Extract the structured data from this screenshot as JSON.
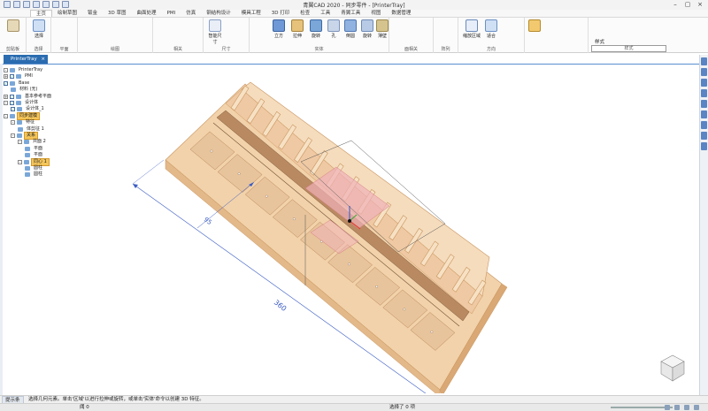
{
  "app": {
    "title": "青翼CAD 2020 - 同步零件 - [PrinterTray]"
  },
  "menu": {
    "tabs": [
      "主页",
      "绘制草图",
      "钣金",
      "3D 草图",
      "曲面处理",
      "PMI",
      "仿真",
      "钢结构设计",
      "模具工程",
      "3D 打印",
      "检查",
      "工具",
      "青翼工具",
      "视图",
      "数据管理"
    ],
    "active_index": 0
  },
  "ribbon": {
    "groups": [
      {
        "name": "剪贴板"
      },
      {
        "name": "选择"
      },
      {
        "name": "平面"
      },
      {
        "name": "绘图"
      },
      {
        "name": "相关"
      },
      {
        "name": "尺寸"
      },
      {
        "name": "实体"
      },
      {
        "name": "面相关"
      },
      {
        "name": "阵列"
      },
      {
        "name": "方向"
      },
      {
        "name": "样式"
      }
    ],
    "buttons": {
      "select": "选择",
      "smart_dim": "智能尺寸",
      "extrude": "立方",
      "stretch": "拉伸",
      "revolve": "旋转",
      "hole": "孔",
      "round": "倒圆",
      "rotate": "旋转",
      "thin": "薄壁",
      "scale": "缩放区域",
      "views": "适合"
    },
    "style_label": "样式"
  },
  "panel": {
    "tab_label": "PrinterTray",
    "close": "×"
  },
  "tree": [
    {
      "label": "PrinterTray",
      "depth": 0,
      "expander": "-",
      "checkbox": false,
      "highlight": false
    },
    {
      "label": "PMI",
      "depth": 0,
      "expander": "+",
      "checkbox": true,
      "highlight": false
    },
    {
      "label": "Base",
      "depth": 0,
      "expander": "",
      "checkbox": true,
      "highlight": false
    },
    {
      "label": "材料 (无)",
      "depth": 1,
      "expander": "",
      "checkbox": false,
      "highlight": false
    },
    {
      "label": "基本参考平面",
      "depth": 0,
      "expander": "+",
      "checkbox": true,
      "highlight": false
    },
    {
      "label": "设计体",
      "depth": 0,
      "expander": "-",
      "checkbox": true,
      "highlight": false
    },
    {
      "label": "设计体_1",
      "depth": 1,
      "expander": "",
      "checkbox": true,
      "highlight": false
    },
    {
      "label": "同步建模",
      "depth": 0,
      "expander": "-",
      "checkbox": false,
      "highlight": true
    },
    {
      "label": "特征",
      "depth": 1,
      "expander": "-",
      "checkbox": false,
      "highlight": false
    },
    {
      "label": "体剪征 1",
      "depth": 2,
      "expander": "",
      "checkbox": false,
      "highlight": false
    },
    {
      "label": "关系",
      "depth": 1,
      "expander": "-",
      "checkbox": false,
      "highlight": true
    },
    {
      "label": "共面 2",
      "depth": 2,
      "expander": "-",
      "checkbox": false,
      "highlight": false
    },
    {
      "label": "平面",
      "depth": 3,
      "expander": "",
      "checkbox": false,
      "highlight": false
    },
    {
      "label": "平面",
      "depth": 3,
      "expander": "",
      "checkbox": false,
      "highlight": false
    },
    {
      "label": "同心 1",
      "depth": 2,
      "expander": "-",
      "checkbox": false,
      "highlight": true
    },
    {
      "label": "圆柱",
      "depth": 3,
      "expander": "",
      "checkbox": false,
      "highlight": false
    },
    {
      "label": "圆柱",
      "depth": 3,
      "expander": "",
      "checkbox": false,
      "highlight": false
    }
  ],
  "dimensions": {
    "d1": "360",
    "d2": "95"
  },
  "status": {
    "tab": "提示条",
    "message": "选择几何元素。单击'区域'以进行拉伸或旋转，或单击'实体'命令以创建 3D 特征。",
    "left": "阈 0",
    "selection": "选择了 0 项"
  },
  "colors": {
    "accent": "#2b6cb0",
    "part_top": "#f2d2aa",
    "part_side": "#e3b98a",
    "part_dark": "#c9955f",
    "dim_line": "#3b5cc4"
  }
}
